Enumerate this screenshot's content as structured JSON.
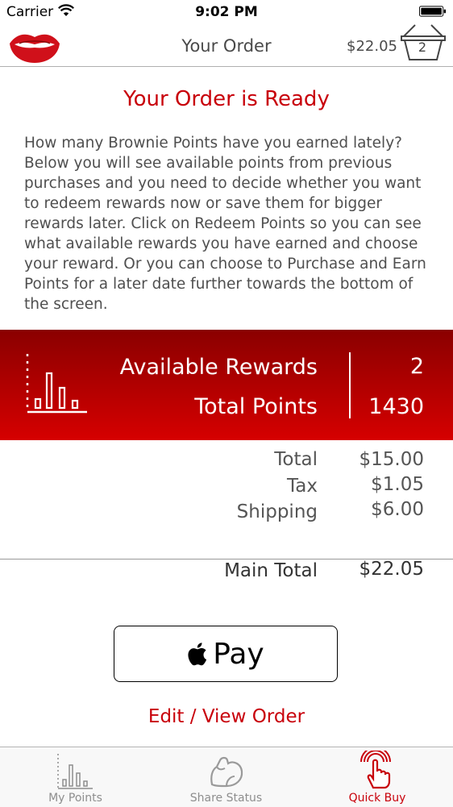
{
  "status_bar": {
    "carrier": "Carrier",
    "time": "9:02 PM"
  },
  "nav": {
    "title": "Your Order",
    "total": "$22.05",
    "basket_count": "2"
  },
  "order": {
    "heading": "Your Order is Ready",
    "description": "How many Brownie Points have you earned lately? Below you will see available points from previous purchases and you need to decide whether you want to redeem rewards now or save them for bigger rewards later. Click on Redeem Points so you can see what available rewards you have earned and choose your reward. Or you can choose to Purchase and Earn Points for a later date further towards the bottom of the screen."
  },
  "rewards": {
    "available_label": "Available Rewards",
    "available_value": "2",
    "points_label": "Total Points",
    "points_value": "1430"
  },
  "totals": {
    "total_label": "Total",
    "total_value": "$15.00",
    "tax_label": "Tax",
    "tax_value": "$1.05",
    "shipping_label": "Shipping",
    "shipping_value": "$6.00",
    "main_total_label": "Main Total",
    "main_total_value": "$22.05"
  },
  "apple_pay": {
    "label": "Pay",
    "icon": "apple-logo-icon"
  },
  "edit_link": "Edit / View Order",
  "tabs": [
    {
      "label": "My Points",
      "icon": "bar-chart-icon",
      "active": false
    },
    {
      "label": "Share Status",
      "icon": "flexed-arm-icon",
      "active": false
    },
    {
      "label": "Quick Buy",
      "icon": "tap-hand-icon",
      "active": true
    }
  ],
  "colors": {
    "accent": "#c8000a",
    "banner_top": "#8a0000",
    "banner_bottom": "#d60000"
  }
}
